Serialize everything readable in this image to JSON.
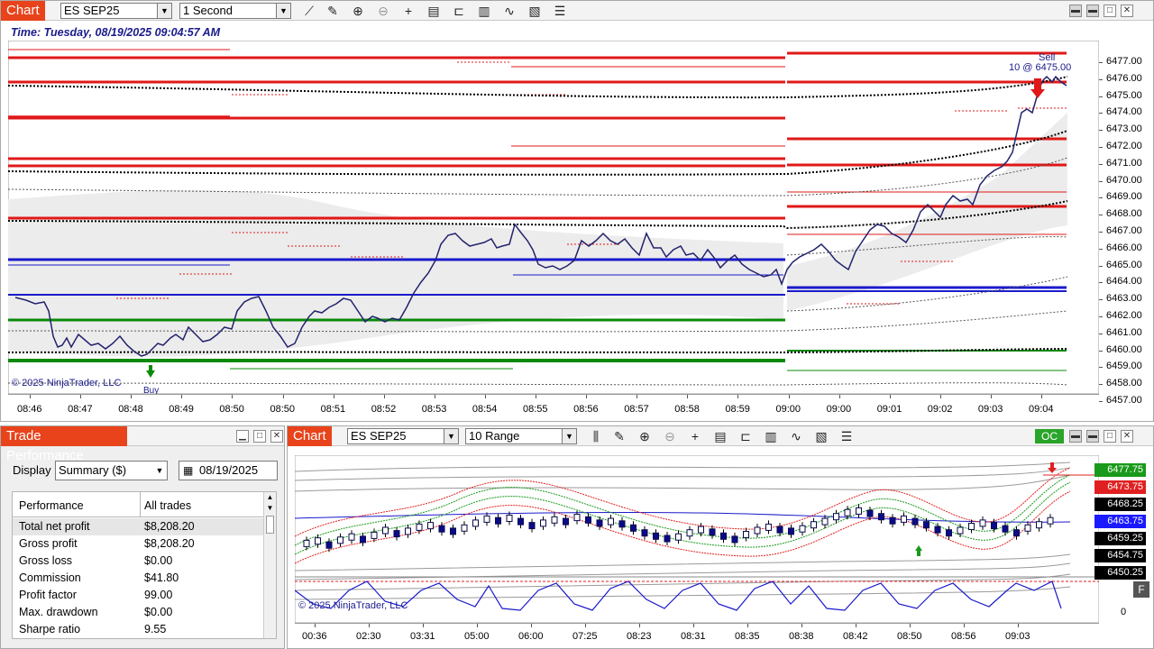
{
  "top_chart": {
    "title": "Chart",
    "instrument": "ES SEP25",
    "interval": "1 Second",
    "time_label": "Time: Tuesday, 08/19/2025 09:04:57 AM",
    "copyright": "© 2025 NinjaTrader, LLC",
    "sell_label": "Sell",
    "sell_detail": "10 @ 6475.00",
    "buy_label": "Buy",
    "price_labels": [
      "6477.00",
      "6476.00",
      "6475.00",
      "6474.00",
      "6473.00",
      "6472.00",
      "6471.00",
      "6470.00",
      "6469.00",
      "6468.00",
      "6467.00",
      "6466.00",
      "6465.00",
      "6464.00",
      "6463.00",
      "6462.00",
      "6461.00",
      "6460.00",
      "6459.00",
      "6458.00",
      "6457.00"
    ],
    "time_labels": [
      "08:46",
      "08:47",
      "08:48",
      "08:49",
      "08:50",
      "08:50",
      "08:51",
      "08:52",
      "08:53",
      "08:54",
      "08:55",
      "08:56",
      "08:57",
      "08:58",
      "08:59",
      "09:00",
      "09:00",
      "09:01",
      "09:02",
      "09:03",
      "09:04"
    ],
    "window_buttons": [
      "▬",
      "▬",
      "□",
      "✕"
    ]
  },
  "trade_performance": {
    "title": "Trade Performance",
    "display_label": "Display",
    "display_value": "Summary ($)",
    "date_value": "08/19/2025",
    "col_performance": "Performance",
    "col_all": "All trades",
    "rows": [
      {
        "label": "Total net profit",
        "value": "$8,208.20"
      },
      {
        "label": "Gross profit",
        "value": "$8,208.20"
      },
      {
        "label": "Gross loss",
        "value": "$0.00"
      },
      {
        "label": "Commission",
        "value": "$41.80"
      },
      {
        "label": "Profit factor",
        "value": "99.00"
      },
      {
        "label": "Max. drawdown",
        "value": "$0.00"
      },
      {
        "label": "Sharpe ratio",
        "value": "9.55"
      }
    ]
  },
  "bottom_chart": {
    "title": "Chart",
    "instrument": "ES SEP25",
    "interval": "10 Range",
    "oc_badge": "OC",
    "copyright": "© 2025 NinjaTrader, LLC",
    "f_button": "F",
    "price_boxes": [
      {
        "value": "6477.75",
        "color": "#1a9a1a"
      },
      {
        "value": "6473.75",
        "color": "#e02020"
      },
      {
        "value": "6468.25",
        "color": "#000000"
      },
      {
        "value": "6463.75",
        "color": "#1a1aff"
      },
      {
        "value": "6459.25",
        "color": "#000000"
      },
      {
        "value": "6454.75",
        "color": "#000000"
      },
      {
        "value": "6450.25",
        "color": "#000000"
      }
    ],
    "osc_zero": "0",
    "time_labels": [
      "00:36",
      "02:30",
      "03:31",
      "05:00",
      "06:00",
      "07:25",
      "08:23",
      "08:31",
      "08:35",
      "08:38",
      "08:42",
      "08:50",
      "08:56",
      "09:03"
    ]
  }
}
